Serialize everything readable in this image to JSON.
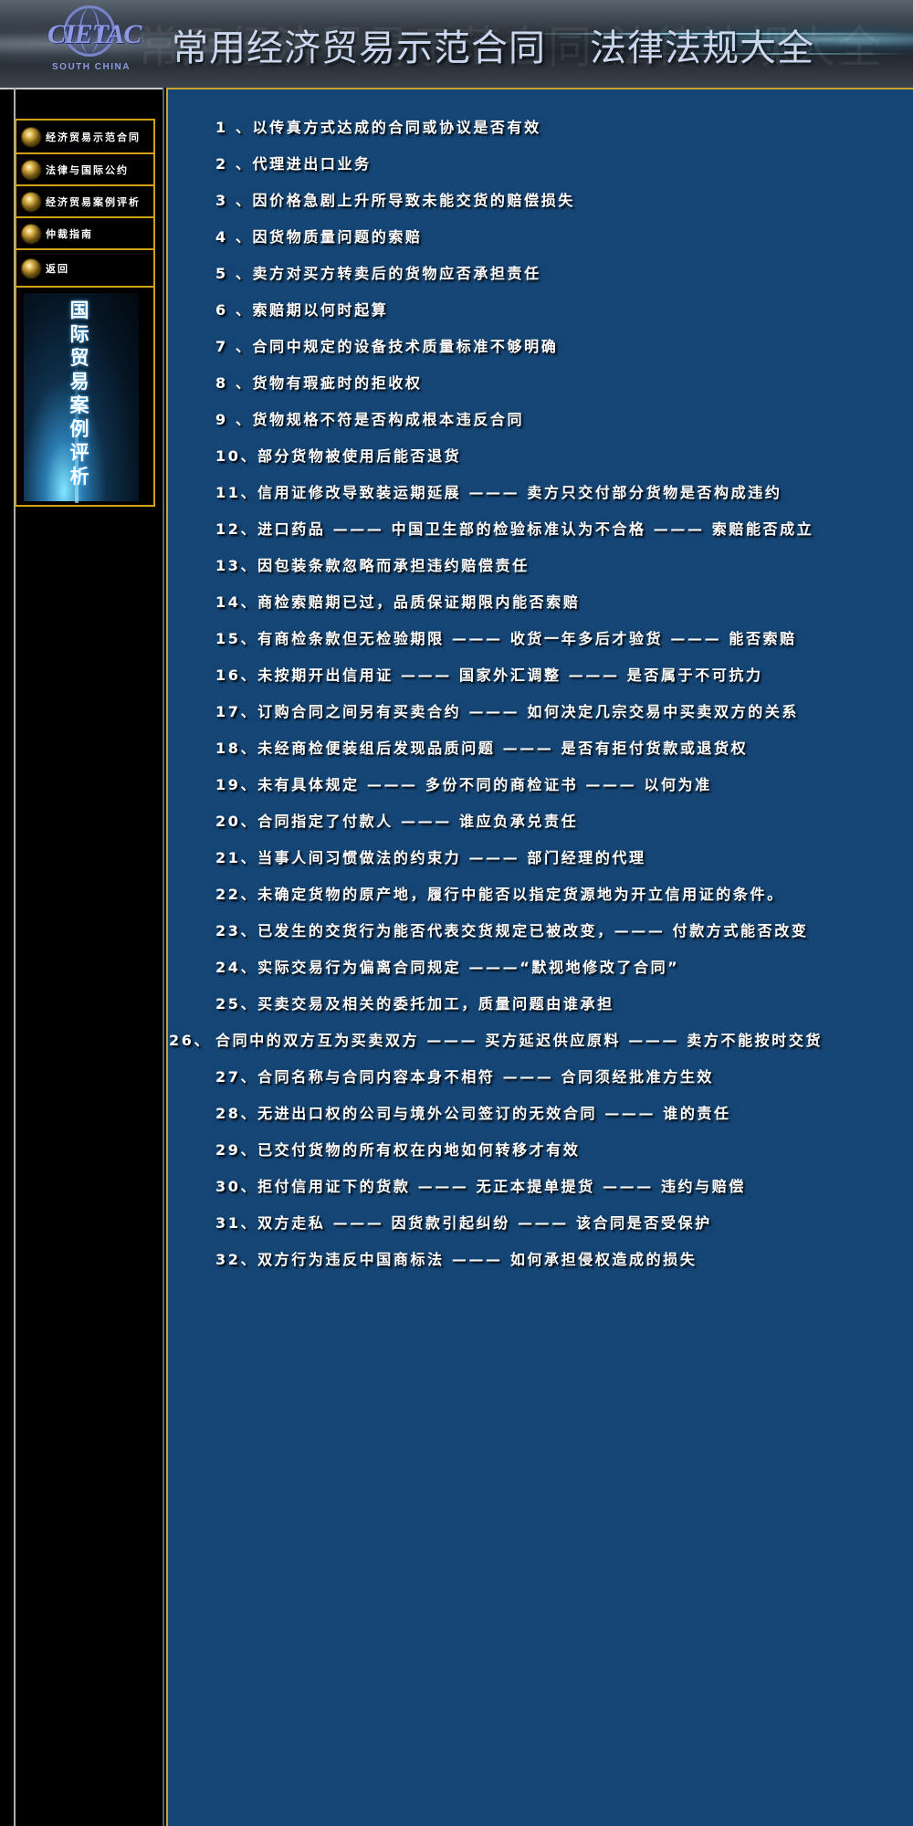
{
  "header": {
    "logo_text": "CIETAC",
    "logo_sub": "SOUTH CHINA",
    "title_left": "常用经济贸易示范合同",
    "title_right": "法律法规大全",
    "ghost_text": "常用经济贸易示范合同 法律法规大全"
  },
  "sidebar": {
    "items": [
      {
        "label": "经济贸易示范合同"
      },
      {
        "label": "法律与国际公约"
      },
      {
        "label": "经济贸易案例评析"
      },
      {
        "label": "仲裁指南"
      },
      {
        "label": "返回"
      }
    ],
    "banner_text": "国际贸易案例评析"
  },
  "cases": [
    {
      "num": "1 、",
      "text": "以传真方式达成的合同或协议是否有效"
    },
    {
      "num": "2 、",
      "text": "代理进出口业务"
    },
    {
      "num": "3 、",
      "text": "因价格急剧上升所导致未能交货的赔偿损失"
    },
    {
      "num": "4 、",
      "text": "因货物质量问题的索赔"
    },
    {
      "num": "5 、",
      "text": "卖方对买方转卖后的货物应否承担责任"
    },
    {
      "num": "6 、",
      "text": "索赔期以何时起算"
    },
    {
      "num": "7 、",
      "text": "合同中规定的设备技术质量标准不够明确"
    },
    {
      "num": "8 、",
      "text": "货物有瑕疵时的拒收权"
    },
    {
      "num": "9 、",
      "text": "货物规格不符是否构成根本违反合同"
    },
    {
      "num": "10、",
      "text": "部分货物被使用后能否退货"
    },
    {
      "num": "11、",
      "text": "信用证修改导致装运期延展 ——— 卖方只交付部分货物是否构成违约"
    },
    {
      "num": "12、",
      "text": "进口药品 ——— 中国卫生部的检验标准认为不合格 ——— 索赔能否成立"
    },
    {
      "num": "13、",
      "text": "因包装条款忽略而承担违约赔偿责任"
    },
    {
      "num": "14、",
      "text": "商检索赔期已过，品质保证期限内能否索赔"
    },
    {
      "num": "15、",
      "text": "有商检条款但无检验期限 ——— 收货一年多后才验货 ——— 能否索赔"
    },
    {
      "num": "16、",
      "text": "未按期开出信用证 ——— 国家外汇调整 ——— 是否属于不可抗力"
    },
    {
      "num": "17、",
      "text": "订购合同之间另有买卖合约 ——— 如何决定几宗交易中买卖双方的关系"
    },
    {
      "num": "18、",
      "text": "未经商检便装组后发现品质问题 ——— 是否有拒付货款或退货权"
    },
    {
      "num": "19、",
      "text": "未有具体规定 ——— 多份不同的商检证书 ——— 以何为准"
    },
    {
      "num": "20、",
      "text": "合同指定了付款人 ——— 谁应负承兑责任"
    },
    {
      "num": "21、",
      "text": "当事人间习惯做法的约束力 ——— 部门经理的代理"
    },
    {
      "num": "22、",
      "text": "未确定货物的原产地，履行中能否以指定货源地为开立信用证的条件。"
    },
    {
      "num": "23、",
      "text": "已发生的交货行为能否代表交货规定已被改变，——— 付款方式能否改变"
    },
    {
      "num": "24、",
      "text": "实际交易行为偏离合同规定 ———“默视地修改了合同”"
    },
    {
      "num": "25、",
      "text": "买卖交易及相关的委托加工，质量问题由谁承担"
    },
    {
      "num": "26、",
      "text": "合同中的双方互为买卖双方 ——— 买方延迟供应原料 ——— 卖方不能按时交货"
    },
    {
      "num": "27、",
      "text": "合同名称与合同内容本身不相符 ——— 合同须经批准方生效"
    },
    {
      "num": "28、",
      "text": "无进出口权的公司与境外公司签订的无效合同 ——— 谁的责任"
    },
    {
      "num": "29、",
      "text": "已交付货物的所有权在内地如何转移才有效"
    },
    {
      "num": "30、",
      "text": "拒付信用证下的货款 ——— 无正本提单提货 ——— 违约与赔偿"
    },
    {
      "num": "31、",
      "text": "双方走私 ——— 因货款引起纠纷 ——— 该合同是否受保护"
    },
    {
      "num": "32、",
      "text": "双方行为违反中国商标法 ——— 如何承担侵权造成的损失"
    }
  ]
}
